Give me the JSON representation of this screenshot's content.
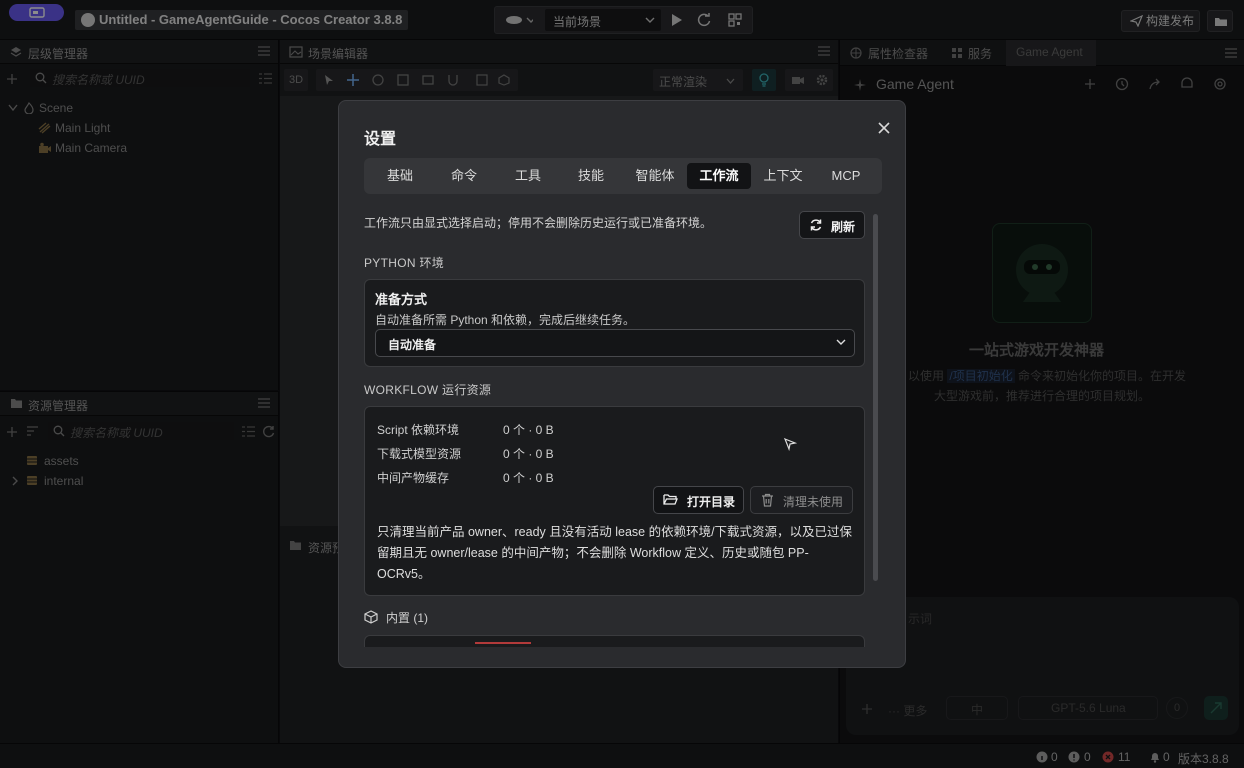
{
  "titlebar": {
    "app_title": "Untitled - GameAgentGuide - Cocos Creator 3.8.8",
    "scene_select": "当前场景",
    "build_label": "构建发布"
  },
  "hierarchy": {
    "title": "层级管理器",
    "search_placeholder": "搜索名称或 UUID",
    "items": [
      "Scene",
      "Main Light",
      "Main Camera"
    ]
  },
  "assets_panel": {
    "title": "资源管理器",
    "search_placeholder": "搜索名称或 UUID",
    "items": [
      "assets",
      "internal"
    ]
  },
  "scene_editor": {
    "title": "场景编辑器",
    "mode_3d": "3D",
    "render_mode": "正常渲染",
    "game_view_title": "资源预"
  },
  "inspector": {
    "tabs": [
      "属性检查器",
      "服务",
      "Game Agent"
    ],
    "agent_title": "Game Agent",
    "hero_title": "一站式游戏开发神器",
    "hero_line1_pre": "以使用",
    "hero_command": "/项目初始化",
    "hero_line1_post": "命令来初始化你的项目。在开发",
    "hero_line2": "大型游戏前，推荐进行合理的项目规划。",
    "input_placeholder": "示词",
    "more": "更多",
    "level": "中",
    "model": "GPT-5.6 Luna",
    "count": "0"
  },
  "statusbar": {
    "info": "0",
    "warn": "0",
    "error": "11",
    "notify": "0",
    "version": "版本3.8.8"
  },
  "modal": {
    "title": "设置",
    "tabs": [
      "基础",
      "命令",
      "工具",
      "技能",
      "智能体",
      "工作流",
      "上下文",
      "MCP"
    ],
    "active_tab": "工作流",
    "description": "工作流只由显式选择启动；停用不会删除历史运行或已准备环境。",
    "refresh_label": "刷新",
    "python_section": "PYTHON 环境",
    "prep_title": "准备方式",
    "prep_desc": "自动准备所需 Python 和依赖，完成后继续任务。",
    "prep_value": "自动准备",
    "workflow_section": "WORKFLOW 运行资源",
    "resources": [
      {
        "label": "Script 依赖环境",
        "value": "0 个 · 0 B"
      },
      {
        "label": "下载式模型资源",
        "value": "0 个 · 0 B"
      },
      {
        "label": "中间产物缓存",
        "value": "0 个 · 0 B"
      }
    ],
    "open_dir_label": "打开目录",
    "clean_label": "清理未使用",
    "note": "只清理当前产品 owner、ready 且没有活动 lease 的依赖环境/下载式资源，以及已过保留期且无 owner/lease 的中间产物；不会删除 Workflow 定义、历史或随包 PP-OCRv5。",
    "builtin_label": "内置 (1)"
  }
}
